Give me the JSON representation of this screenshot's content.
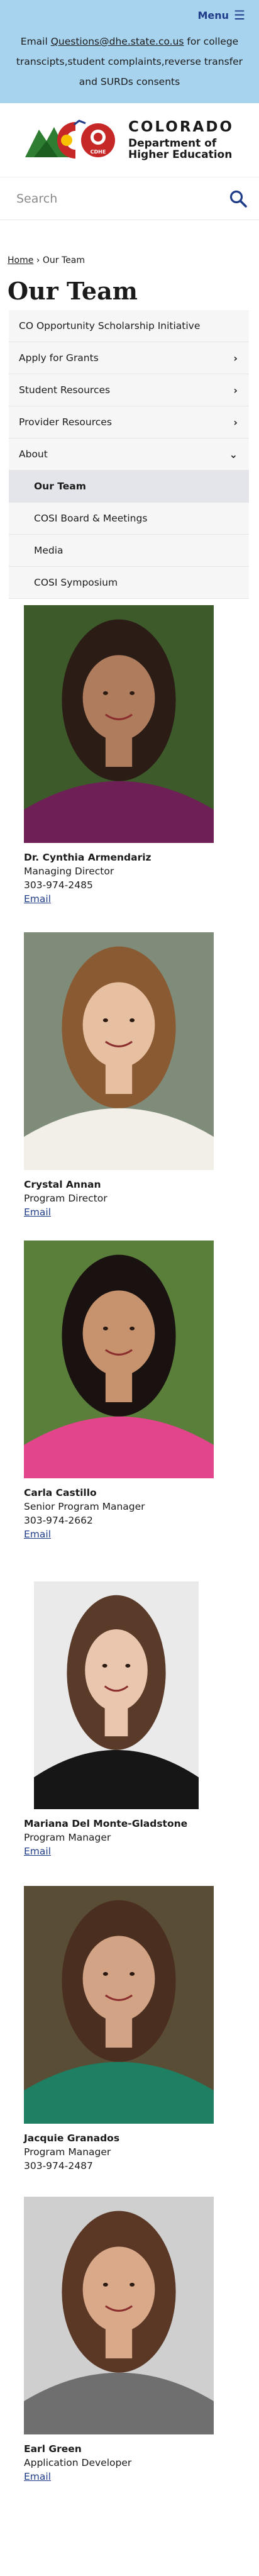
{
  "header": {
    "menu_label": "Menu",
    "notice_prefix": "Email ",
    "notice_email": "Questions@dhe.state.co.us",
    "notice_suffix": " for college transcipts,student complaints,reverse transfer and SURDs consents"
  },
  "brand": {
    "badge_text": "CDHE",
    "state": "COLORADO",
    "dept_line1": "Department of",
    "dept_line2": "Higher Education"
  },
  "search": {
    "placeholder": "Search"
  },
  "breadcrumb": {
    "home": "Home",
    "sep": "›",
    "current": "Our Team"
  },
  "page_title": "Our Team",
  "sidenav": {
    "items": [
      {
        "label": "CO Opportunity Scholarship Initiative",
        "chevron": ""
      },
      {
        "label": "Apply for Grants",
        "chevron": "›"
      },
      {
        "label": "Student Resources",
        "chevron": "›"
      },
      {
        "label": "Provider Resources",
        "chevron": "›"
      },
      {
        "label": "About",
        "chevron": "⌄"
      }
    ],
    "sub_items": [
      {
        "label": "Our Team"
      },
      {
        "label": "COSI Board & Meetings"
      },
      {
        "label": "Media"
      },
      {
        "label": "COSI Symposium"
      }
    ]
  },
  "staff": [
    {
      "name": "Dr. Cynthia Armendariz",
      "title": "Managing Director",
      "phone": "303-974-2485",
      "email": "Email",
      "skin": "#b07c5e",
      "hair": "#2b1d16",
      "shirt": "#6e1f55",
      "bg": "#3d5a2b"
    },
    {
      "name": "Crystal Annan",
      "title": "Program Director",
      "phone": "",
      "email": "Email",
      "skin": "#e7bfa1",
      "hair": "#8a5a33",
      "shirt": "#f2efe9",
      "bg": "#7f8c7a"
    },
    {
      "name": "Carla Castillo",
      "title": "Senior Program Manager",
      "phone": "303-974-2662",
      "email": "Email",
      "skin": "#c7936f",
      "hair": "#1a1210",
      "shirt": "#e2458c",
      "bg": "#5a7f3a"
    },
    {
      "name": "Mariana Del Monte-Gladstone",
      "title": "Program Manager",
      "phone": "",
      "email": "Email",
      "skin": "#e9c6ad",
      "hair": "#5a3b2a",
      "shirt": "#161616",
      "bg": "#eaeaea"
    },
    {
      "name": "Jacquie Granados",
      "title": "Program Manager",
      "phone": "303-974-2487",
      "email": "Email",
      "skin": "#d3a385",
      "hair": "#4a2e1f",
      "shirt": "#1e7f62",
      "bg": "#5a4d35"
    },
    {
      "name": "Earl Green",
      "title": "Application Developer",
      "phone": "",
      "email": "Email",
      "skin": "#d9a98a",
      "hair": "#5b3826",
      "shirt": "#6f6f6f",
      "bg": "#cfcfcf"
    }
  ]
}
